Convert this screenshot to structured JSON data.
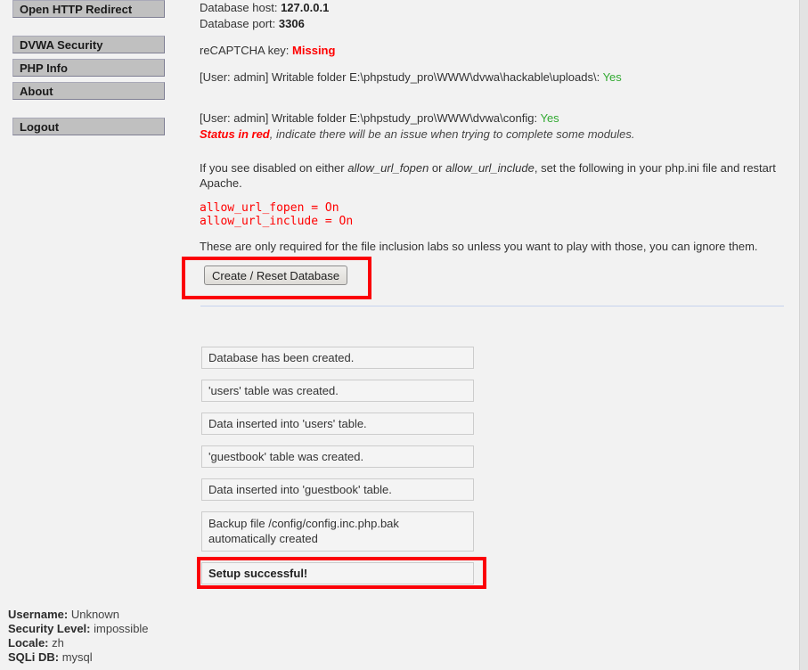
{
  "sidebar": {
    "groups": [
      {
        "items": [
          {
            "label": "Open HTTP Redirect",
            "name": "sidebar-item-open-http-redirect"
          }
        ]
      },
      {
        "items": [
          {
            "label": "DVWA Security",
            "name": "sidebar-item-dvwa-security"
          },
          {
            "label": "PHP Info",
            "name": "sidebar-item-php-info"
          },
          {
            "label": "About",
            "name": "sidebar-item-about"
          }
        ]
      },
      {
        "items": [
          {
            "label": "Logout",
            "name": "sidebar-item-logout"
          }
        ]
      }
    ]
  },
  "status_footer": {
    "username_label": "Username:",
    "username_value": "Unknown",
    "security_level_label": "Security Level:",
    "security_level_value": "impossible",
    "locale_label": "Locale:",
    "locale_value": "zh",
    "sqli_db_label": "SQLi DB:",
    "sqli_db_value": "mysql"
  },
  "main": {
    "db_host_label": "Database host:",
    "db_host_value": "127.0.0.1",
    "db_port_label": "Database port:",
    "db_port_value": "3306",
    "recaptcha_label": "reCAPTCHA key:",
    "recaptcha_value": "Missing",
    "uploads_label": "[User: admin] Writable folder E:\\phpstudy_pro\\WWW\\dvwa\\hackable\\uploads\\:",
    "uploads_value": "Yes",
    "config_label": "[User: admin] Writable folder E:\\phpstudy_pro\\WWW\\dvwa\\config:",
    "config_value": "Yes",
    "status_red_emphasis": "Status in red",
    "status_red_rest": ", indicate there will be an issue when trying to complete some modules.",
    "php_ini_note_pre": "If you see disabled on either ",
    "php_ini_note_fopen": "allow_url_fopen",
    "php_ini_note_mid": " or ",
    "php_ini_note_include": "allow_url_include",
    "php_ini_note_post": ", set the following in your php.ini file and restart Apache.",
    "code_line_1": "allow_url_fopen = On",
    "code_line_2": "allow_url_include = On",
    "inclusion_note": "These are only required for the file inclusion labs so unless you want to play with those, you can ignore them.",
    "reset_button_label": "Create / Reset Database"
  },
  "messages": [
    {
      "text": "Database has been created.",
      "two_line": false,
      "success": false
    },
    {
      "text": "'users' table was created.",
      "two_line": false,
      "success": false
    },
    {
      "text": "Data inserted into 'users' table.",
      "two_line": false,
      "success": false
    },
    {
      "text": "'guestbook' table was created.",
      "two_line": false,
      "success": false
    },
    {
      "text": "Data inserted into 'guestbook' table.",
      "two_line": false,
      "success": false
    },
    {
      "text": "Backup file /config/config.inc.php.bak automatically created",
      "two_line": true,
      "success": false
    },
    {
      "text": "Setup successful!",
      "two_line": false,
      "success": true
    }
  ],
  "colors": {
    "highlight_red": "#fb0007",
    "status_red": "#ff0000",
    "status_green": "#33aa33",
    "nav_button_bg": "#c0c0c0",
    "page_bg": "#f2f2f2",
    "divider": "#c6d2ee"
  }
}
